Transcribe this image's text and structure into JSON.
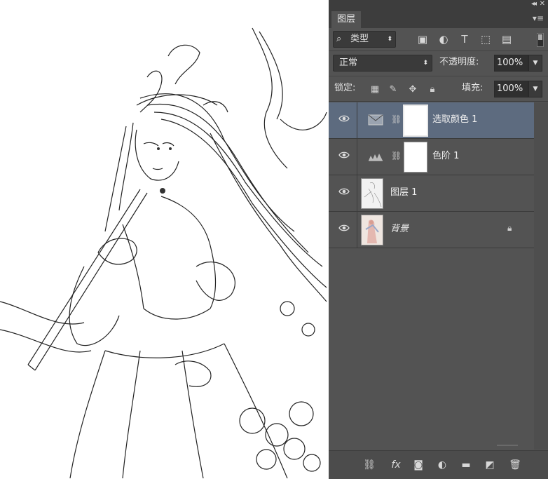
{
  "panel": {
    "tab_label": "图层",
    "filter": {
      "value": "类型",
      "search_icon": "⌕"
    },
    "blend_mode": "正常",
    "opacity_label": "不透明度:",
    "opacity_value": "100%",
    "lock_label": "锁定:",
    "fill_label": "填充:",
    "fill_value": "100%"
  },
  "layers": [
    {
      "name": "选取颜色 1",
      "type": "adjustment-selective-color",
      "selected": true,
      "visible": true
    },
    {
      "name": "色阶 1",
      "type": "adjustment-levels",
      "selected": false,
      "visible": true
    },
    {
      "name": "图层 1",
      "type": "pixel",
      "selected": false,
      "visible": true
    },
    {
      "name": "背景",
      "type": "background",
      "selected": false,
      "visible": true,
      "locked": true
    }
  ],
  "colors": {
    "panel_bg": "#535353",
    "selected_layer": "#5d6b7f",
    "dark_bar": "#3d3d3d"
  }
}
